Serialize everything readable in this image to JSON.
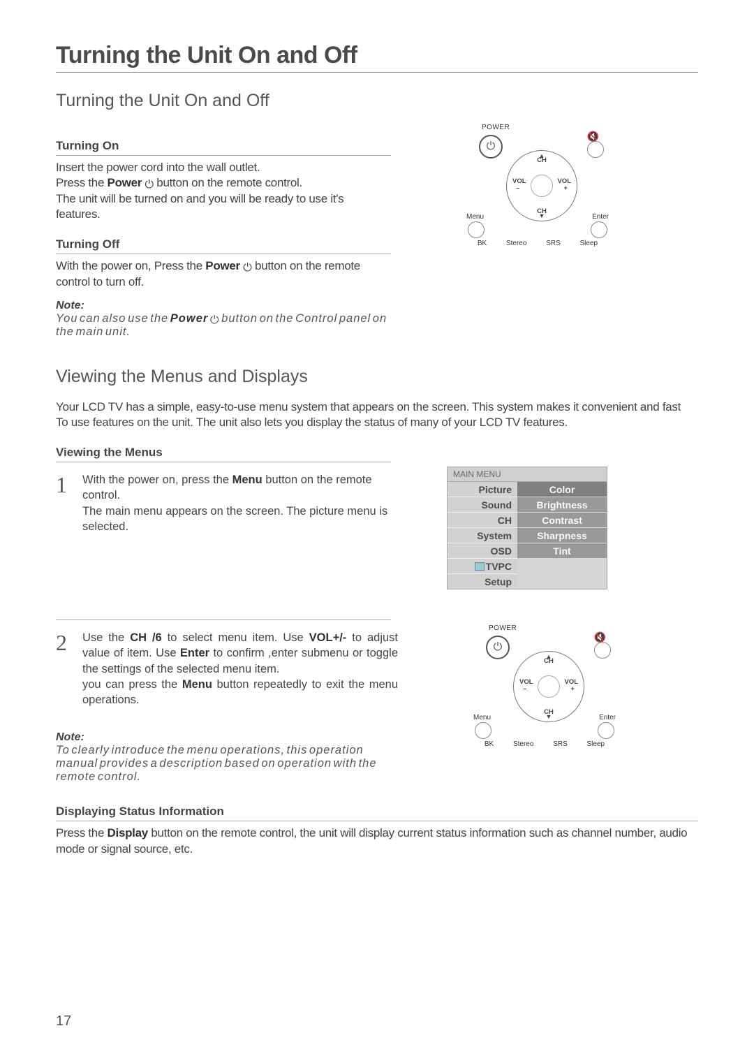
{
  "page": {
    "title": "Turning the Unit On and Off",
    "subtitle": "Turning the Unit On and Off",
    "pageNumber": "17"
  },
  "section_on": {
    "heading": "Turning On",
    "line1a": "Insert the power cord into the wall outlet.",
    "line2a": "Press the ",
    "line2b": "Power",
    "line2c": " button on the remote control.",
    "line3": "The unit will be turned on and you will be ready to use it's features."
  },
  "section_off": {
    "heading": "Turning Off",
    "line1a": "With the power on, Press the ",
    "line1b": "Power",
    "line1c": " button on the remote control to turn off."
  },
  "note1": {
    "head": "Note:",
    "body_a": "You can also use the ",
    "body_b": "Power",
    "body_c": " button on the Control panel on the main unit."
  },
  "section_menus": {
    "subtitle": "Viewing the Menus and Displays",
    "intro1": "Your LCD TV has a simple, easy-to-use menu system that appears on the screen. This system makes it convenient and fast",
    "intro2": "To use features on the unit. The unit also lets you display the status of many of your LCD TV features.",
    "heading": "Viewing the Menus",
    "step1_num": "1",
    "step1_a": "With the power on, press the ",
    "step1_b": "Menu",
    "step1_c": " button on the remote control.",
    "step1_d": "The main menu appears on the screen. The picture menu is selected.",
    "step2_num": "2",
    "step2_a": "Use the ",
    "step2_b": "CH   /6",
    "step2_c": "  to select menu item. Use ",
    "step2_d": "VOL+/-",
    "step2_e": " to adjust value   of item. Use ",
    "step2_f": "Enter",
    "step2_g": " to confirm ,enter submenu or toggle the settings of the selected menu item.",
    "step2_h1": "you  can  press  the  ",
    "step2_h2": "Menu",
    "step2_h3": "  button  repeatedly  to  exit  the  menu operations."
  },
  "note2": {
    "head": "Note:",
    "body": "To clearly introduce the menu operations, this operation manual provides a description based on operation with the remote control."
  },
  "section_status": {
    "heading": "Displaying Status Information",
    "body_a": "Press the ",
    "body_b": "Display",
    "body_c": " button on the remote control, the unit will display current status information such as channel number, audio mode or signal source, etc."
  },
  "remote": {
    "power": "POWER",
    "ch": "CH",
    "vol": "VOL",
    "minus": "–",
    "plus": "+",
    "menu": "Menu",
    "enter": "Enter",
    "bk": "BK",
    "stereo": "Stereo",
    "srs": "SRS",
    "sleep": "Sleep"
  },
  "osd": {
    "title": "MAIN MENU",
    "left": [
      "Picture",
      "Sound",
      "CH",
      "System",
      "OSD",
      "TVPC",
      "Setup"
    ],
    "right": [
      "Color",
      "Brightness",
      "Contrast",
      "Sharpness",
      "Tint"
    ]
  },
  "icons": {
    "power": "⏻",
    "mute": "🔇",
    "up": "▲",
    "down": "▼"
  }
}
